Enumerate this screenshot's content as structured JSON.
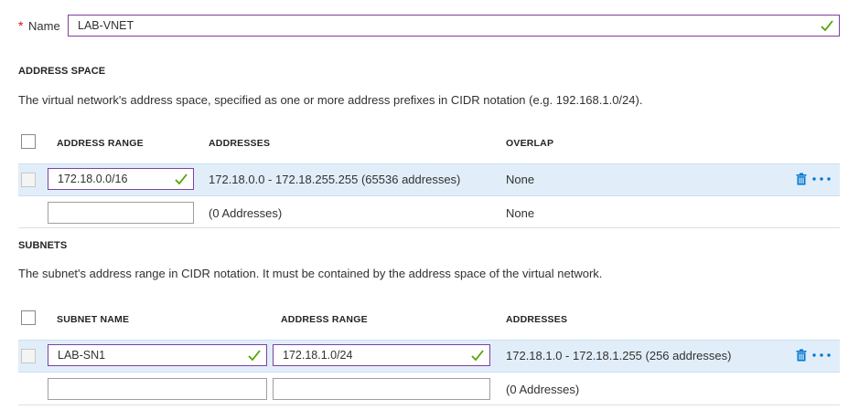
{
  "name_field": {
    "required_marker": "*",
    "label": "Name",
    "value": "LAB-VNET"
  },
  "address_space": {
    "heading": "ADDRESS SPACE",
    "description": "The virtual network's address space, specified as one or more address prefixes in CIDR notation (e.g. 192.168.1.0/24).",
    "columns": [
      "ADDRESS RANGE",
      "ADDRESSES",
      "OVERLAP"
    ],
    "rows": [
      {
        "address_range": "172.18.0.0/16",
        "addresses": "172.18.0.0 - 172.18.255.255 (65536 addresses)",
        "overlap": "None"
      }
    ],
    "new_row": {
      "address_range": "",
      "addresses": "(0 Addresses)",
      "overlap": "None"
    }
  },
  "subnets": {
    "heading": "SUBNETS",
    "description": "The subnet's address range in CIDR notation. It must be contained by the address space of the virtual network.",
    "columns": [
      "SUBNET NAME",
      "ADDRESS RANGE",
      "ADDRESSES"
    ],
    "rows": [
      {
        "subnet_name": "LAB-SN1",
        "address_range": "172.18.1.0/24",
        "addresses": "172.18.1.0 - 172.18.1.255 (256 addresses)"
      }
    ],
    "new_row": {
      "subnet_name": "",
      "address_range": "",
      "addresses": "(0 Addresses)"
    }
  },
  "icons": {
    "valid": "checkmark-icon",
    "delete": "trash-icon",
    "more": "ellipsis-icon"
  },
  "colors": {
    "accent": "#0078d4",
    "valid_check": "#57a300",
    "focus_border": "#7f3fa3",
    "selected_row": "#e1eef9",
    "required": "#e00b1c"
  }
}
